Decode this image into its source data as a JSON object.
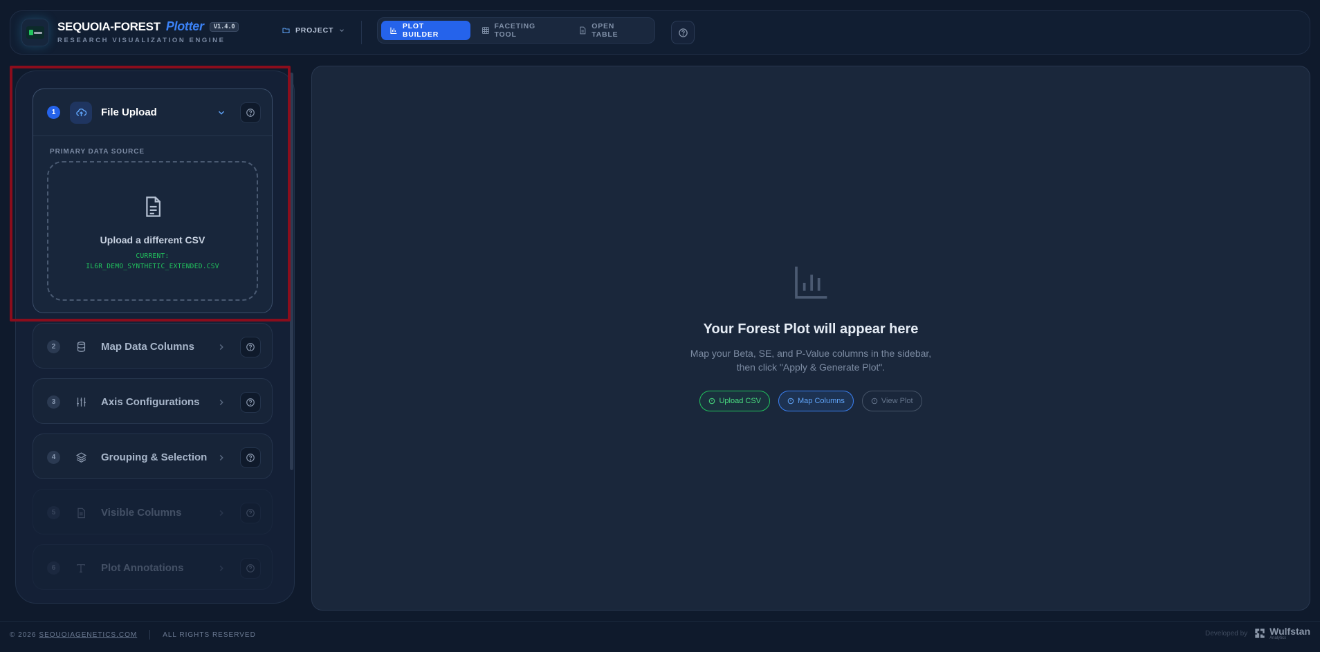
{
  "header": {
    "brand_main": "SEQUOIA-FOREST",
    "brand_sub": "Plotter",
    "version": "V1.4.0",
    "tagline": "RESEARCH VISUALIZATION ENGINE",
    "project_label": "PROJECT",
    "tabs": [
      {
        "label": "PLOT BUILDER",
        "icon": "bar-chart-icon",
        "active": true
      },
      {
        "label": "FACETING TOOL",
        "icon": "grid-icon",
        "active": false
      },
      {
        "label": "OPEN TABLE",
        "icon": "document-icon",
        "active": false
      }
    ]
  },
  "sidebar": {
    "steps": [
      {
        "num": "1",
        "title": "File Upload",
        "icon": "cloud-upload-icon",
        "state": "open"
      },
      {
        "num": "2",
        "title": "Map Data Columns",
        "icon": "database-icon",
        "state": "enabled"
      },
      {
        "num": "3",
        "title": "Axis Configurations",
        "icon": "sliders-icon",
        "state": "enabled"
      },
      {
        "num": "4",
        "title": "Grouping & Selection",
        "icon": "layers-icon",
        "state": "enabled"
      },
      {
        "num": "5",
        "title": "Visible Columns",
        "icon": "document-icon",
        "state": "disabled"
      },
      {
        "num": "6",
        "title": "Plot Annotations",
        "icon": "text-icon",
        "state": "disabled"
      }
    ],
    "upload": {
      "source_label": "PRIMARY DATA SOURCE",
      "title": "Upload a different CSV",
      "current_label": "CURRENT:",
      "current_file": "IL6R_DEMO_SYNTHETIC_EXTENDED.CSV"
    }
  },
  "main": {
    "empty_title": "Your Forest Plot will appear here",
    "empty_desc_1": "Map your Beta, SE, and P-Value columns in the sidebar,",
    "empty_desc_2": "then click \"Apply & Generate Plot\".",
    "pills": [
      {
        "label": "Upload CSV",
        "state": "done"
      },
      {
        "label": "Map Columns",
        "state": "current"
      },
      {
        "label": "View Plot",
        "state": "pending"
      }
    ]
  },
  "footer": {
    "copyright": "© 2026",
    "site_link": "SEQUOIAGENETICS.COM",
    "rights": "ALL RIGHTS RESERVED",
    "developed_by": "Developed by",
    "dev_name": "Wulfstan",
    "dev_sub": "Analytics"
  },
  "colors": {
    "accent": "#2563eb",
    "success": "#22c55e",
    "background": "#0f1a2c",
    "highlight": "#8b0d1c"
  }
}
